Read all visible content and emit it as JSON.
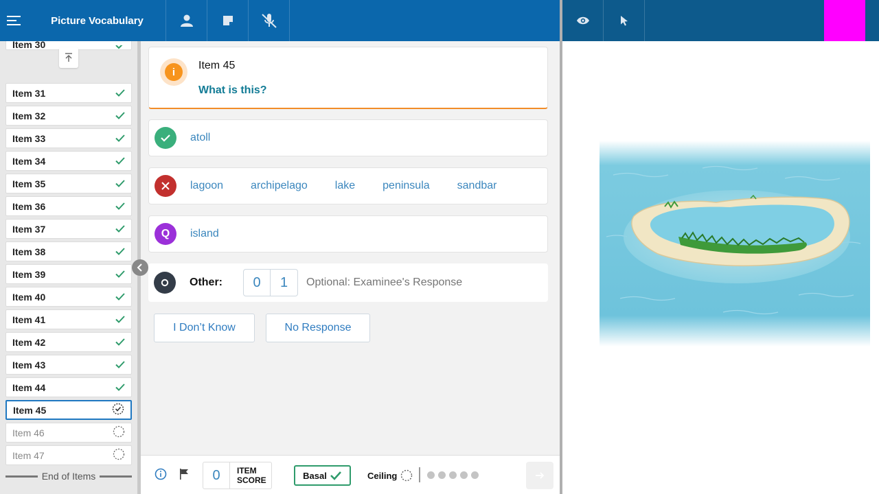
{
  "app": {
    "title": "Picture Vocabulary"
  },
  "colors": {
    "topbar_left": "#0b67ac",
    "topbar_right": "#0d5a8c",
    "magenta_block": "#ff00ff",
    "correct": "#3aaf7c",
    "incorrect": "#c2302e",
    "query": "#9b30d9",
    "other": "#333c48",
    "info": "#f7941d"
  },
  "toolbar": {
    "icons": [
      "menu-icon",
      "person-icon",
      "note-icon",
      "mic-off-icon",
      "eye-icon",
      "pointer-icon"
    ]
  },
  "sidebar": {
    "partial_item": "Item 30",
    "items": [
      {
        "label": "Item 31",
        "state": "done"
      },
      {
        "label": "Item 32",
        "state": "done"
      },
      {
        "label": "Item 33",
        "state": "done"
      },
      {
        "label": "Item 34",
        "state": "done"
      },
      {
        "label": "Item 35",
        "state": "done"
      },
      {
        "label": "Item 36",
        "state": "done"
      },
      {
        "label": "Item 37",
        "state": "done"
      },
      {
        "label": "Item 38",
        "state": "done"
      },
      {
        "label": "Item 39",
        "state": "done"
      },
      {
        "label": "Item 40",
        "state": "done"
      },
      {
        "label": "Item 41",
        "state": "done"
      },
      {
        "label": "Item 42",
        "state": "done"
      },
      {
        "label": "Item 43",
        "state": "done"
      },
      {
        "label": "Item 44",
        "state": "done"
      },
      {
        "label": "Item 45",
        "state": "current"
      },
      {
        "label": "Item 46",
        "state": "pending"
      },
      {
        "label": "Item 47",
        "state": "pending"
      }
    ],
    "end_label": "End of Items"
  },
  "question": {
    "item_label": "Item 45",
    "prompt": "What is this?"
  },
  "responses": {
    "correct": [
      "atoll"
    ],
    "incorrect": [
      "lagoon",
      "archipelago",
      "lake",
      "peninsula",
      "sandbar"
    ],
    "query": [
      "island"
    ],
    "other_label": "Other:",
    "other_score_0": "0",
    "other_score_1": "1",
    "other_placeholder": "Optional: Examinee's Response"
  },
  "buttons": {
    "dont_know": "I Don’t Know",
    "no_response": "No Response"
  },
  "bottom": {
    "item_score_value": "0",
    "item_score_line1": "ITEM",
    "item_score_line2": "SCORE",
    "basal_label": "Basal",
    "ceiling_label": "Ceiling",
    "ceiling_dots": 5
  }
}
